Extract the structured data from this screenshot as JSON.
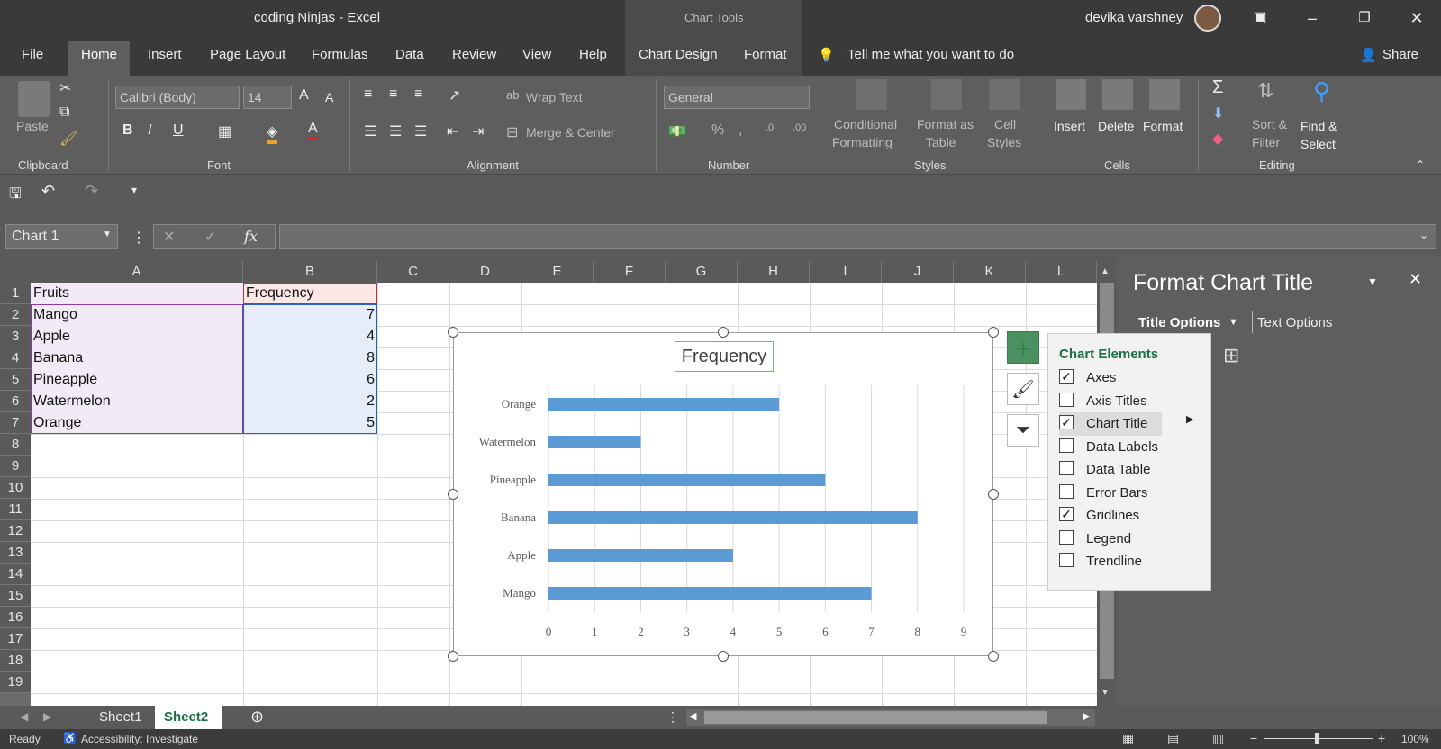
{
  "title_bar": {
    "document": "coding Ninjas  -  Excel",
    "context_label": "Chart Tools",
    "user": "devika varshney"
  },
  "tabs": [
    "File",
    "Home",
    "Insert",
    "Page Layout",
    "Formulas",
    "Data",
    "Review",
    "View",
    "Help",
    "Chart Design",
    "Format"
  ],
  "tell_me": "Tell me what you want to do",
  "share": "Share",
  "ribbon": {
    "clipboard": {
      "paste": "Paste",
      "label": "Clipboard"
    },
    "font": {
      "name": "Calibri (Body)",
      "size": "14",
      "label": "Font"
    },
    "alignment": {
      "wrap": "Wrap Text",
      "merge": "Merge & Center",
      "label": "Alignment"
    },
    "number": {
      "format": "General",
      "label": "Number"
    },
    "styles": {
      "cond1": "Conditional",
      "cond2": "Formatting",
      "fmt1": "Format as",
      "fmt2": "Table",
      "cell1": "Cell",
      "cell2": "Styles",
      "label": "Styles"
    },
    "cells": {
      "insert": "Insert",
      "delete": "Delete",
      "format": "Format",
      "label": "Cells"
    },
    "editing": {
      "sort1": "Sort &",
      "sort2": "Filter",
      "find1": "Find &",
      "find2": "Select",
      "label": "Editing"
    }
  },
  "name_box": "Chart 1",
  "columns": [
    "A",
    "B",
    "C",
    "D",
    "E",
    "F",
    "G",
    "H",
    "I",
    "J",
    "K",
    "L"
  ],
  "rows": [
    "1",
    "2",
    "3",
    "4",
    "5",
    "6",
    "7",
    "8",
    "9",
    "10",
    "11",
    "12",
    "13",
    "14",
    "15",
    "16",
    "17",
    "18",
    "19"
  ],
  "cells": {
    "a1": "Fruits",
    "b1": "Frequency",
    "a2": "Mango",
    "b2": "7",
    "a3": "Apple",
    "b3": "4",
    "a4": "Banana",
    "b4": "8",
    "a5": "Pineapple",
    "b5": "6",
    "a6": "Watermelon",
    "b6": "2",
    "a7": "Orange",
    "b7": "5"
  },
  "chart_data": {
    "type": "bar",
    "orientation": "horizontal",
    "title": "Frequency",
    "categories": [
      "Orange",
      "Watermelon",
      "Pineapple",
      "Banana",
      "Apple",
      "Mango"
    ],
    "values": [
      5,
      2,
      6,
      8,
      4,
      7
    ],
    "xlim": [
      0,
      9
    ],
    "xticks": [
      "0",
      "1",
      "2",
      "3",
      "4",
      "5",
      "6",
      "7",
      "8",
      "9"
    ],
    "grid": true,
    "legend": "none",
    "bar_color": "#5b9bd5"
  },
  "chart_elements": {
    "header": "Chart Elements",
    "items": [
      {
        "label": "Axes",
        "checked": true
      },
      {
        "label": "Axis Titles",
        "checked": false
      },
      {
        "label": "Chart Title",
        "checked": true
      },
      {
        "label": "Data Labels",
        "checked": false
      },
      {
        "label": "Data Table",
        "checked": false
      },
      {
        "label": "Error Bars",
        "checked": false
      },
      {
        "label": "Gridlines",
        "checked": true
      },
      {
        "label": "Legend",
        "checked": false
      },
      {
        "label": "Trendline",
        "checked": false
      }
    ]
  },
  "format_pane": {
    "title": "Format Chart Title",
    "tab_title": "Title Options",
    "tab_text": "Text Options"
  },
  "sheets": [
    "Sheet1",
    "Sheet2"
  ],
  "status": {
    "ready": "Ready",
    "accessibility": "Accessibility: Investigate",
    "zoom": "100%"
  },
  "colors": {
    "accent": "#1e7145",
    "chart_bar": "#5b9bd5"
  }
}
